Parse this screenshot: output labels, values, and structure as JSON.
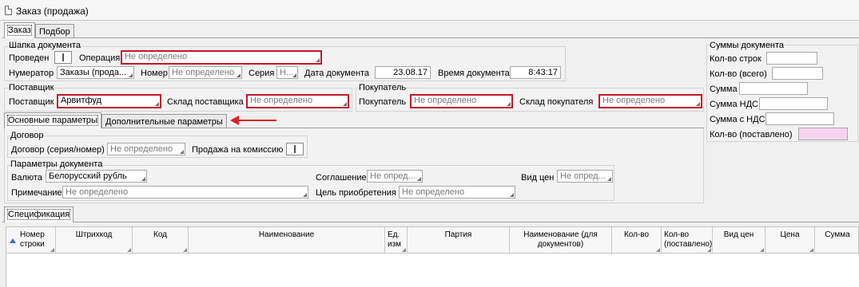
{
  "window": {
    "title": "Заказ (продажа)"
  },
  "top_tabs": [
    "Заказ",
    "Подбор"
  ],
  "header_group": {
    "title": "Шапка документа",
    "posted_label": "Проведен",
    "operation_label": "Операция",
    "operation_value": "Не определено",
    "numerator_label": "Нумератор",
    "numerator_value": "Заказы (прода...",
    "number_label": "Номер",
    "number_value": "Не определено",
    "series_label": "Серия",
    "series_value": "Н...",
    "date_label": "Дата документа",
    "date_value": "23.08.17",
    "time_label": "Время документа",
    "time_value": "8:43:17"
  },
  "supplier_group": {
    "title": "Поставщик",
    "supplier_label": "Поставщик",
    "supplier_value": "Арвитфуд",
    "warehouse_label": "Склад поставщика",
    "warehouse_value": "Не определено"
  },
  "buyer_group": {
    "title": "Покупатель",
    "buyer_label": "Покупатель",
    "buyer_value": "Не определено",
    "warehouse_label": "Склад покупателя",
    "warehouse_value": "Не определено"
  },
  "sums_group": {
    "title": "Суммы документа",
    "rows_label": "Кол-во строк",
    "qty_total_label": "Кол-во (всего)",
    "sum_label": "Сумма",
    "vat_label": "Сумма НДС",
    "sum_with_vat_label": "Сумма с НДС",
    "qty_delivered_label": "Кол-во (поставлено)",
    "rows_value": "",
    "qty_total_value": "",
    "sum_value": "",
    "vat_value": "",
    "sum_with_vat_value": "",
    "qty_delivered_value": ""
  },
  "param_tabs": [
    "Основные параметры",
    "Дополнительные параметры"
  ],
  "contract_group": {
    "title": "Договор",
    "contract_label": "Договор (серия/номер)",
    "contract_value": "Не определено",
    "commission_label": "Продажа на комиссию"
  },
  "doc_params_group": {
    "title": "Параметры документа",
    "currency_label": "Валюта",
    "currency_value": "Белорусский рубль",
    "agreement_label": "Соглашение",
    "agreement_value": "Не опред...",
    "price_type_label": "Вид цен",
    "price_type_value": "Не опред...",
    "note_label": "Примечание",
    "note_value": "Не определено",
    "purpose_label": "Цель приобретения",
    "purpose_value": "Не определено"
  },
  "spec_tab": "Спецификация",
  "table_columns": [
    "Номер строки",
    "Штрихкод",
    "Код",
    "Наименование",
    "Ед. изм",
    "Партия",
    "Наименование (для документов)",
    "Кол-во",
    "Кол-во (поставлено)",
    "Вид цен",
    "Цена",
    "Сумма"
  ],
  "colors": {
    "highlight_border": "#c2182b",
    "annotation_arrow": "#dd2222",
    "pink_field": "#f6d3ef",
    "sort_icon": "#3a6cc9"
  },
  "icons": [
    "document-icon",
    "sort-ascending-icon",
    "dropdown-corner-icon",
    "arrow-left-annotation"
  ]
}
